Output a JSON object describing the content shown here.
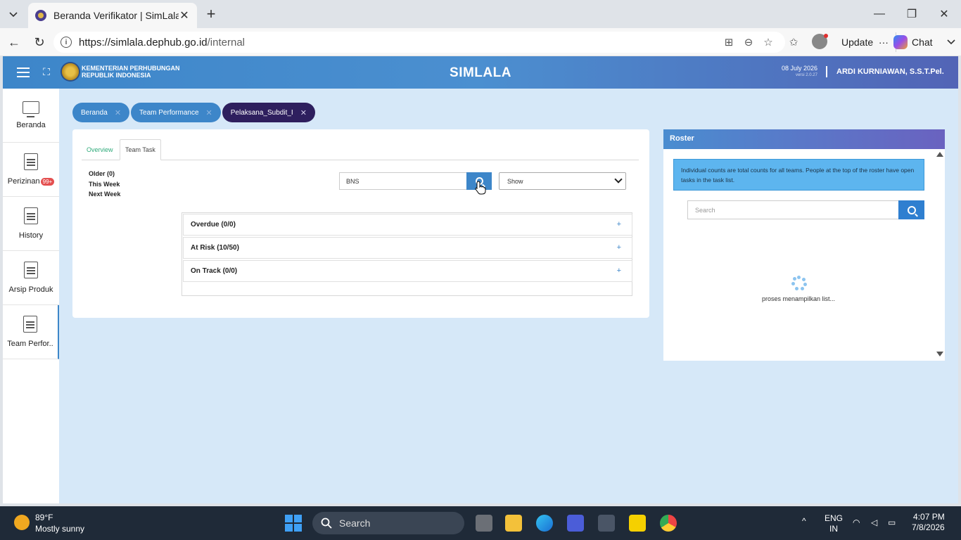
{
  "browser": {
    "tab_title": "Beranda Verifikator | SimLala",
    "url_host": "https://simlala.dephub.go.id",
    "url_path": "/internal",
    "update_label": "Update",
    "chat_label": "Chat"
  },
  "header": {
    "ministry_line1": "KEMENTERIAN PERHUBUNGAN",
    "ministry_line2": "REPUBLIK INDONESIA",
    "app_title": "SIMLALA",
    "date": "08 July 2026",
    "version": "versi 2.0.27",
    "user": "ARDI KURNIAWAN, S.S.T.Pel."
  },
  "sidebar": {
    "items": [
      {
        "label": "Beranda",
        "icon": "monitor-icon"
      },
      {
        "label": "Perizinan",
        "icon": "document-icon",
        "badge": "99+"
      },
      {
        "label": "History",
        "icon": "document-icon"
      },
      {
        "label": "Arsip Produk",
        "icon": "document-icon"
      },
      {
        "label": "Team Perfor..",
        "icon": "document-icon"
      }
    ]
  },
  "breadcrumbs": [
    "Beranda",
    "Team Performance",
    "Pelaksana_Subdit_I"
  ],
  "main": {
    "tabs": [
      "Overview",
      "Team Task"
    ],
    "periods": [
      "Older (0)",
      "This Week",
      "Next Week"
    ],
    "search_value": "BNS",
    "select_value": "Show",
    "accordion": [
      "Overdue (0/0)",
      "At Risk (10/50)",
      "On Track (0/0)"
    ]
  },
  "roster": {
    "title": "Roster",
    "note": "Individual counts are total counts for all teams. People at the top of the roster have open tasks in the task list.",
    "search_placeholder": "Search",
    "loading_text": "proses menampilkan list..."
  },
  "taskbar": {
    "temp": "89°F",
    "weather": "Mostly sunny",
    "search_label": "Search",
    "lang1": "ENG",
    "lang2": "IN",
    "time": "4:07 PM",
    "date": "7/8/2026"
  }
}
